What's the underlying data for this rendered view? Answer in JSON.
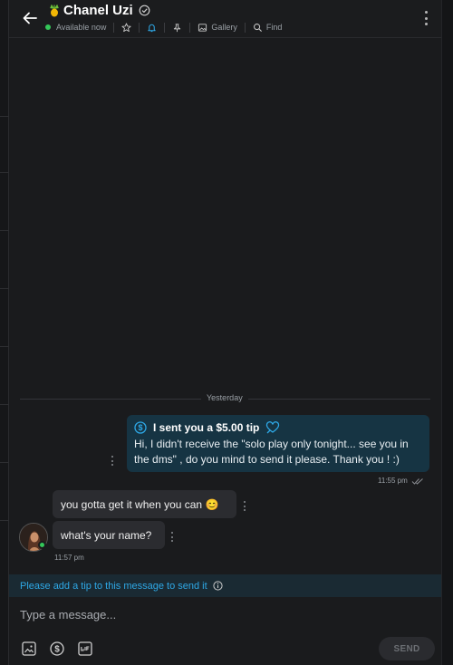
{
  "header": {
    "name": "Chanel Uzi",
    "status": "Available now",
    "gallery_label": "Gallery",
    "find_label": "Find"
  },
  "chat": {
    "date_divider": "Yesterday",
    "tip_message": {
      "title": "I sent you a $5.00 tip",
      "text": "Hi, I didn't receive the \"solo play only tonight... see you in the dms\" , do you mind to send it please. Thank you ! :)",
      "time": "11:55 pm"
    },
    "incoming": [
      {
        "text": "you gotta get it when you can 😊"
      },
      {
        "text": "what's your name?"
      }
    ],
    "incoming_time": "11:57 pm"
  },
  "notice": {
    "text": "Please add a tip to this message to send it"
  },
  "composer": {
    "placeholder": "Type a message...",
    "send_label": "SEND"
  },
  "colors": {
    "accent": "#2ea8e6",
    "tip_bubble": "#163443",
    "online": "#34c759"
  },
  "icons": [
    "back-arrow-icon",
    "pineapple-icon",
    "verified-icon",
    "star-icon",
    "bell-icon",
    "pin-icon",
    "gallery-icon",
    "search-icon",
    "more-icon",
    "dollar-coin-icon",
    "heart-icon",
    "info-icon",
    "image-icon",
    "tip-icon",
    "gif-icon"
  ]
}
